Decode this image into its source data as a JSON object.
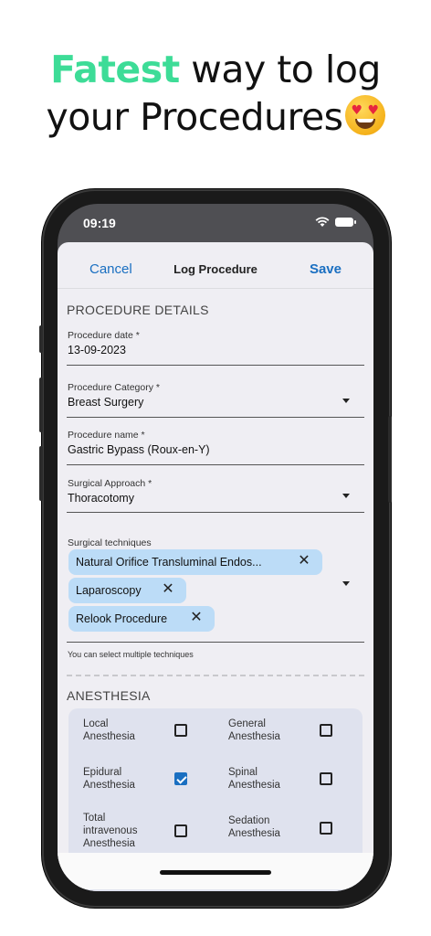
{
  "headline": {
    "accent_word": "Fatest",
    "line1_rest": " way to log",
    "line2": "your Procedures",
    "emoji": "heart-eyes-emoji"
  },
  "status_bar": {
    "time": "09:19"
  },
  "nav": {
    "cancel": "Cancel",
    "title": "Log Procedure",
    "save": "Save"
  },
  "procedure_details": {
    "section_title": "PROCEDURE DETAILS",
    "date": {
      "label": "Procedure date *",
      "value": "13-09-2023"
    },
    "category": {
      "label": "Procedure Category *",
      "value": "Breast Surgery"
    },
    "name": {
      "label": "Procedure name *",
      "value": "Gastric Bypass (Roux-en-Y)"
    },
    "approach": {
      "label": "Surgical Approach *",
      "value": "Thoracotomy"
    },
    "techniques": {
      "label": "Surgical techniques",
      "chips": [
        "Natural Orifice Transluminal Endos...",
        "Laparoscopy",
        "Relook Procedure"
      ],
      "helper": "You can select multiple techniques"
    }
  },
  "anesthesia": {
    "section_title": "ANESTHESIA",
    "options": [
      {
        "label": "Local Anesthesia",
        "checked": false
      },
      {
        "label": "General Anesthesia",
        "checked": false
      },
      {
        "label": "Epidural Anesthesia",
        "checked": true
      },
      {
        "label": "Spinal Anesthesia",
        "checked": false
      },
      {
        "label": "Total intravenous Anesthesia",
        "checked": false
      },
      {
        "label": "Sedation Anesthesia",
        "checked": false
      }
    ]
  },
  "colors": {
    "accent_green": "#3ddc97",
    "link_blue": "#1a6fc1",
    "chip_bg": "#bcdcf7"
  }
}
